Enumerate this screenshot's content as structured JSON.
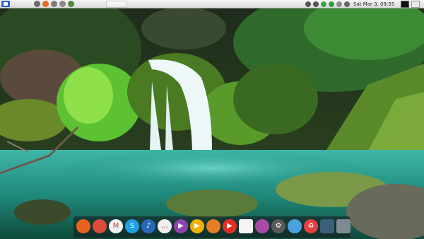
{
  "top_panel": {
    "clock": "Sat Mar  3, 09:55",
    "launchers": [
      {
        "name": "desktop-icon",
        "color": "#6b6b6b"
      },
      {
        "name": "firefox-icon",
        "color": "#e86a1e"
      },
      {
        "name": "settings-icon",
        "color": "#7a7a7a"
      },
      {
        "name": "email-icon",
        "color": "#8a8a8a"
      },
      {
        "name": "photo-icon",
        "color": "#4a8a3a"
      }
    ],
    "tray": [
      {
        "name": "network-icon",
        "color": "#555555"
      },
      {
        "name": "volume-icon",
        "color": "#555555"
      },
      {
        "name": "battery-icon",
        "color": "#3aa24a"
      },
      {
        "name": "update-check-icon",
        "color": "#2e9e4a"
      },
      {
        "name": "user-icon",
        "color": "#888888"
      },
      {
        "name": "power-icon",
        "color": "#666666"
      }
    ]
  },
  "dock": {
    "items": [
      {
        "name": "firefox-icon",
        "color": "#e8641c",
        "glyph": ""
      },
      {
        "name": "chrome-icon",
        "color": "#dd4b39",
        "glyph": ""
      },
      {
        "name": "gmail-icon",
        "color": "#f1f1f1",
        "glyph": "M"
      },
      {
        "name": "skype-icon",
        "color": "#1fa0e6",
        "glyph": "S"
      },
      {
        "name": "music-player-icon",
        "color": "#2968b8",
        "glyph": "♪"
      },
      {
        "name": "chat-icon",
        "color": "#efefef",
        "glyph": "…"
      },
      {
        "name": "video-player-icon",
        "color": "#8e44ad",
        "glyph": "▶"
      },
      {
        "name": "media-icon",
        "color": "#f0b000",
        "glyph": "▶"
      },
      {
        "name": "clock-icon",
        "color": "#e67e22",
        "glyph": ""
      },
      {
        "name": "youtube-icon",
        "color": "#e52d27",
        "glyph": "▶"
      },
      {
        "name": "text-editor-icon",
        "color": "#f4f4f4",
        "glyph": ""
      },
      {
        "name": "document-viewer-icon",
        "color": "#a64ca6",
        "glyph": ""
      },
      {
        "name": "system-settings-icon",
        "color": "#5a5a5a",
        "glyph": "⚙"
      },
      {
        "name": "maps-icon",
        "color": "#4aa3df",
        "glyph": ""
      },
      {
        "name": "recycle-icon",
        "color": "#e84040",
        "glyph": "♻"
      },
      {
        "name": "workspace-icon",
        "color": "#3b5f78",
        "glyph": ""
      },
      {
        "name": "trash-icon",
        "color": "#7d8a91",
        "glyph": ""
      }
    ]
  }
}
